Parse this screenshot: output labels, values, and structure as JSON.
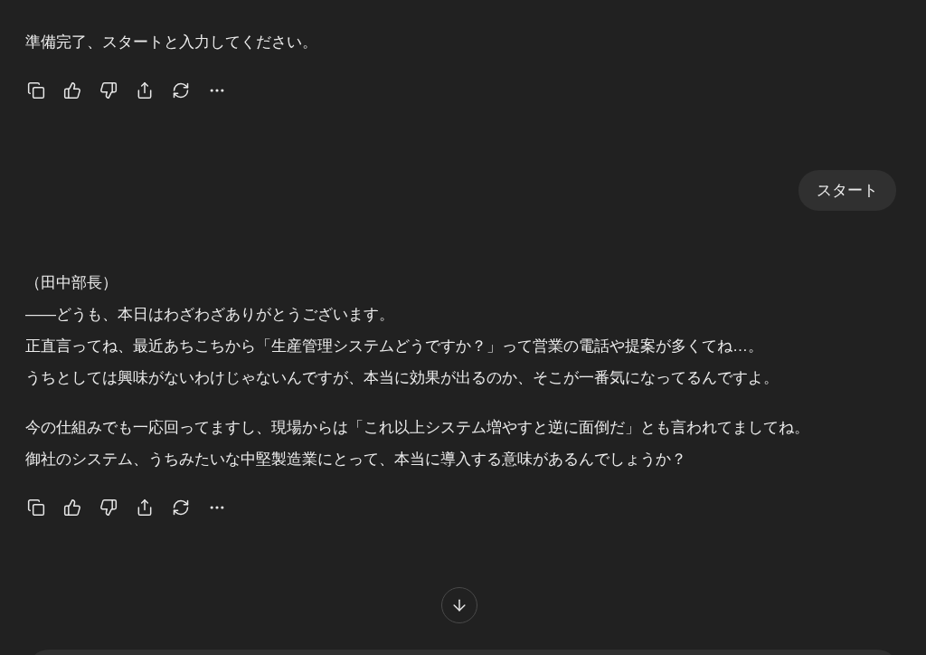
{
  "messages": [
    {
      "kind": "assistant",
      "paragraphs": [
        [
          "準備完了、スタートと入力してください。"
        ]
      ]
    },
    {
      "kind": "user",
      "text": "スタート"
    },
    {
      "kind": "assistant",
      "paragraphs": [
        [
          "（田中部長）",
          "――どうも、本日はわざわざありがとうございます。",
          "正直言ってね、最近あちこちから「生産管理システムどうですか？」って営業の電話や提案が多くてね…。",
          "うちとしては興味がないわけじゃないんですが、本当に効果が出るのか、そこが一番気になってるんですよ。"
        ],
        [
          "今の仕組みでも一応回ってますし、現場からは「これ以上システム増やすと逆に面倒だ」とも言われてましてね。",
          "御社のシステム、うちみたいな中堅製造業にとって、本当に導入する意味があるんでしょうか？"
        ]
      ]
    }
  ]
}
